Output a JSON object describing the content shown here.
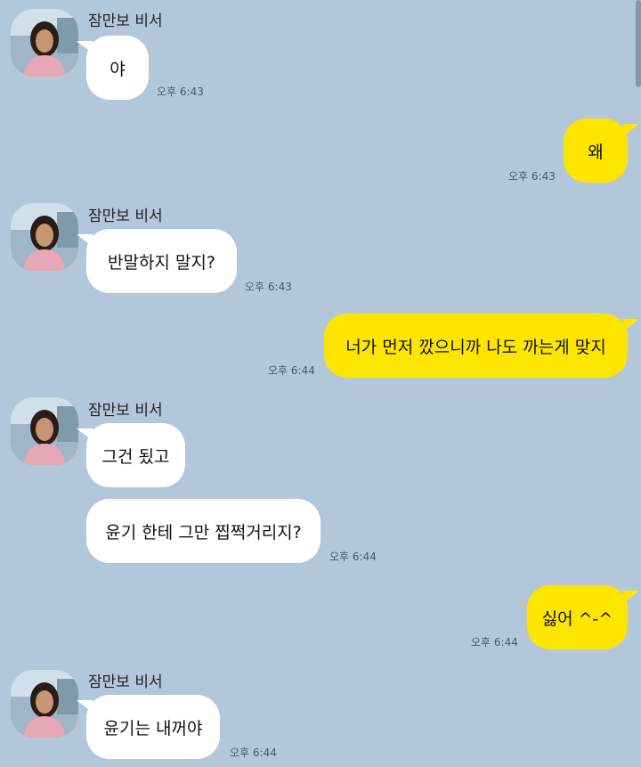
{
  "chat": {
    "sender_name": "잠만보 비서",
    "messages": [
      {
        "side": "in",
        "text": "야",
        "time": "오후 6:43"
      },
      {
        "side": "out",
        "text": "왜",
        "time": "오후 6:43"
      },
      {
        "side": "in",
        "text": "반말하지 말지?",
        "time": "오후 6:43"
      },
      {
        "side": "out",
        "text": "너가 먼저 깠으니까 나도 까는게 맞지",
        "time": "오후 6:44"
      },
      {
        "side": "in",
        "text": "그건 됬고",
        "time": ""
      },
      {
        "side": "in",
        "text": "윤기 한테 그만 찝쩍거리지?",
        "time": "오후 6:44"
      },
      {
        "side": "out",
        "text": "싫어 ^-^",
        "time": "오후 6:44"
      },
      {
        "side": "in",
        "text": "윤기는 내꺼야",
        "time": "오후 6:44"
      }
    ]
  },
  "colors": {
    "background": "#b2c7da",
    "incoming_bubble": "#ffffff",
    "outgoing_bubble": "#fee500"
  }
}
